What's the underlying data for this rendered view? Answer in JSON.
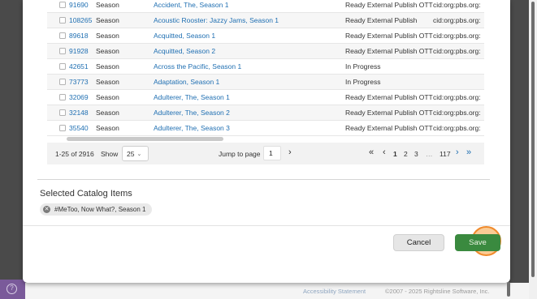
{
  "rows": [
    {
      "id": "91690",
      "type": "Season",
      "title": "Accident, The, Season 1",
      "status": "Ready External Publish OTT",
      "urn": "cid:org:pbs.org:"
    },
    {
      "id": "108265",
      "type": "Season",
      "title": "Acoustic Rooster: Jazzy Jams, Season 1",
      "status": "Ready External Publish",
      "urn": "cid:org:pbs.org:"
    },
    {
      "id": "89618",
      "type": "Season",
      "title": "Acquitted, Season 1",
      "status": "Ready External Publish OTT",
      "urn": "cid:org:pbs.org:"
    },
    {
      "id": "91928",
      "type": "Season",
      "title": "Acquitted, Season 2",
      "status": "Ready External Publish OTT",
      "urn": "cid:org:pbs.org:"
    },
    {
      "id": "42651",
      "type": "Season",
      "title": "Across the Pacific, Season 1",
      "status": "In Progress",
      "urn": ""
    },
    {
      "id": "73773",
      "type": "Season",
      "title": "Adaptation, Season 1",
      "status": "In Progress",
      "urn": ""
    },
    {
      "id": "32069",
      "type": "Season",
      "title": "Adulterer, The, Season 1",
      "status": "Ready External Publish OTT",
      "urn": "cid:org:pbs.org:"
    },
    {
      "id": "32148",
      "type": "Season",
      "title": "Adulterer, The, Season 2",
      "status": "Ready External Publish OTT",
      "urn": "cid:org:pbs.org:"
    },
    {
      "id": "35540",
      "type": "Season",
      "title": "Adulterer, The, Season 3",
      "status": "Ready External Publish OTT",
      "urn": "cid:org:pbs.org:"
    }
  ],
  "pager": {
    "range": "1-25 of 2916",
    "show_label": "Show",
    "page_size": "25",
    "jump_label": "Jump to page",
    "jump_value": "1",
    "pages": [
      "1",
      "2",
      "3"
    ],
    "ellipsis": "…",
    "last_page": "117",
    "first_icon": "«",
    "prev_icon": "‹",
    "next_icon": "›",
    "last_icon": "»",
    "go_icon": "›"
  },
  "selected": {
    "title": "Selected Catalog Items",
    "chips": [
      "#MeToo, Now What?, Season 1"
    ]
  },
  "actions": {
    "cancel": "Cancel",
    "save": "Save"
  },
  "footer": {
    "accessibility": "Accessibility Statement",
    "copyright": "©2007 - 2025 Rightsline Software, Inc."
  },
  "colors": {
    "link": "#1f6fb2",
    "save": "#3a8a3f",
    "click_highlight": "#f08a2c"
  }
}
